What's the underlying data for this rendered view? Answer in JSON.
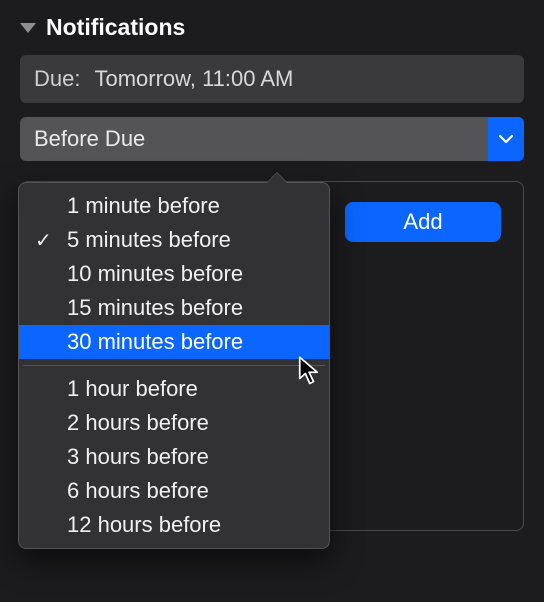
{
  "section": {
    "title": "Notifications"
  },
  "due": {
    "label": "Due:",
    "value": "Tomorrow, 11:00 AM"
  },
  "dropdown": {
    "label": "Before Due"
  },
  "add": {
    "label": "Add"
  },
  "menu": {
    "group1": [
      {
        "label": "1 minute before",
        "checked": false,
        "highlight": false
      },
      {
        "label": "5 minutes before",
        "checked": true,
        "highlight": false
      },
      {
        "label": "10 minutes before",
        "checked": false,
        "highlight": false
      },
      {
        "label": "15 minutes before",
        "checked": false,
        "highlight": false
      },
      {
        "label": "30 minutes before",
        "checked": false,
        "highlight": true
      }
    ],
    "group2": [
      {
        "label": "1 hour before"
      },
      {
        "label": "2 hours before"
      },
      {
        "label": "3 hours before"
      },
      {
        "label": "6 hours before"
      },
      {
        "label": "12 hours before"
      }
    ]
  }
}
